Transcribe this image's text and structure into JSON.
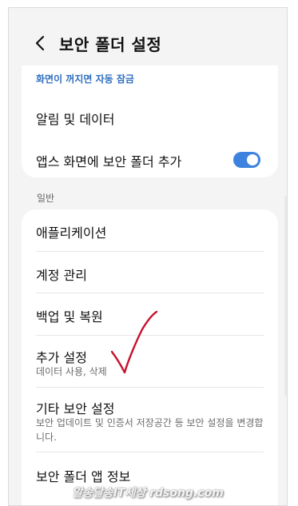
{
  "header": {
    "title": "보안 폴더 설정",
    "back_icon": "chevron-left-icon"
  },
  "group1": {
    "lock_link": "화면이 꺼지면 자동 잠금",
    "notifications": "알림 및 데이터",
    "add_to_apps": "앱스 화면에 보안 폴더 추가",
    "add_to_apps_toggle": true
  },
  "section_general": "일반",
  "group2": {
    "applications": "애플리케이션",
    "accounts": "계정 관리",
    "backup": "백업 및 복원",
    "more_settings": "추가 설정",
    "more_settings_sub": "데이터 사용, 삭제",
    "other_security": "기타 보안 설정",
    "other_security_sub": "보안 업데이트 및 인증서 저장공간 등 보안 설정을 변경합니다.",
    "about": "보안 폴더 앱 정보"
  },
  "watermark": "알송달송IT세상 rdsong.com",
  "colors": {
    "accent": "#3e82e0",
    "link": "#2f6fbf",
    "annotation": "#c8102e"
  }
}
